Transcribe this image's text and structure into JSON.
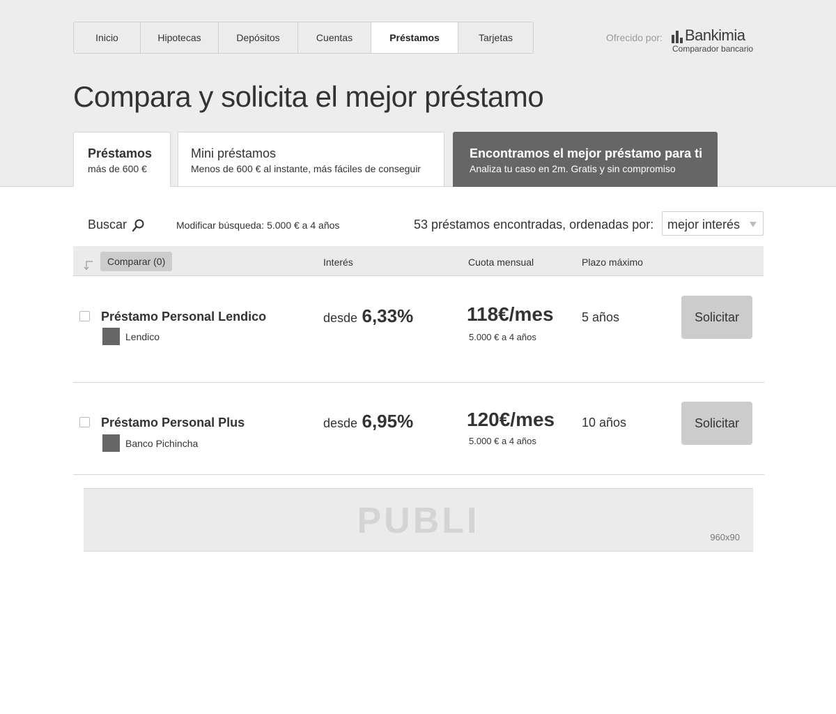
{
  "nav": {
    "tabs": [
      {
        "label": "Inicio"
      },
      {
        "label": "Hipotecas"
      },
      {
        "label": "Depósitos"
      },
      {
        "label": "Cuentas"
      },
      {
        "label": "Préstamos"
      },
      {
        "label": "Tarjetas"
      }
    ],
    "active_tab": "Préstamos"
  },
  "sponsor": {
    "offered_label": "Ofrecido por:",
    "brand_name": "Bankimia",
    "brand_tagline": "Comparador bancario"
  },
  "page_title": "Compara y solicita el mejor préstamo",
  "product_tabs": [
    {
      "title": "Préstamos",
      "subtitle": "más de 600 €",
      "state": "active"
    },
    {
      "title": "Mini préstamos",
      "subtitle": "Menos de 600 € al instante, más fáciles de conseguir",
      "state": "inactive"
    },
    {
      "title": "Encontramos el mejor préstamo para ti",
      "subtitle": "Analiza tu caso en 2m. Gratis y sin compromiso",
      "state": "cta"
    }
  ],
  "search": {
    "buscar_label": "Buscar",
    "modify_label": "Modificar búsqueda:",
    "modify_value": "5.000 € a 4 años",
    "results_text": "53 préstamos encontradas, ordenadas por:",
    "sort_selected": "mejor interés"
  },
  "table": {
    "compare_label": "Comparar (0)",
    "col_interest": "Interés",
    "col_cuota": "Cuota mensual",
    "col_plazo": "Plazo máximo"
  },
  "loans": [
    {
      "name": "Préstamo Personal Lendico",
      "bank": "Lendico",
      "interest_prefix": "desde",
      "interest": "6,33%",
      "cuota": "118€/mes",
      "cuota_detail": "5.000 € a 4 años",
      "plazo": "5 años",
      "cta": "Solicitar"
    },
    {
      "name": "Préstamo Personal Plus",
      "bank": "Banco Pichincha",
      "interest_prefix": "desde",
      "interest": "6,95%",
      "cuota": "120€/mes",
      "cuota_detail": "5.000 € a 4 años",
      "plazo": "10 años",
      "cta": "Solicitar"
    }
  ],
  "ad": {
    "label": "PUBLI",
    "size": "960x90"
  },
  "colors": {
    "background": "#ededed",
    "cta_tab": "#666666",
    "button": "#cccccc",
    "text": "#333333"
  }
}
